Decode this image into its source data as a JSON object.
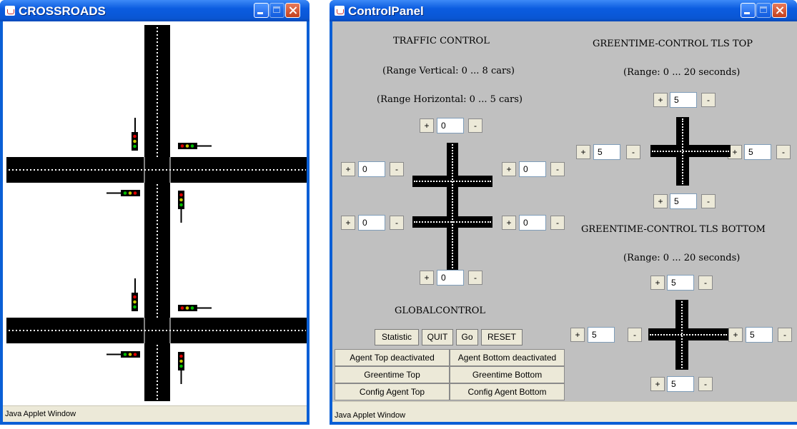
{
  "crossroads_window": {
    "title": "CROSSROADS",
    "status": "Java Applet Window"
  },
  "control_panel": {
    "title": "ControlPanel",
    "status": "Java Applet Window",
    "traffic": {
      "heading": "TRAFFIC CONTROL",
      "range_vertical": "(Range Vertical: 0 ... 8 cars)",
      "range_horizontal": "(Range Horizontal: 0 ... 5 cars)",
      "top": "0",
      "upper_left": "0",
      "upper_right": "0",
      "lower_left": "0",
      "lower_right": "0",
      "bottom": "0"
    },
    "global": {
      "heading": "GLOBALCONTROL",
      "statistic": "Statistic",
      "quit": "QUIT",
      "go": "Go",
      "reset": "RESET",
      "agent_top": "Agent Top deactivated",
      "agent_bottom": "Agent Bottom deactivated",
      "greentime_top": "Greentime Top",
      "greentime_bottom": "Greentime Bottom",
      "config_top": "Config Agent Top",
      "config_bottom": "Config Agent Bottom"
    },
    "tls_top": {
      "heading": "GREENTIME-CONTROL TLS TOP",
      "range": "(Range: 0 ... 20 seconds)",
      "north": "5",
      "west": "5",
      "east": "5",
      "south": "5"
    },
    "tls_bottom": {
      "heading": "GREENTIME-CONTROL TLS BOTTOM",
      "range": "(Range: 0 ... 20 seconds)",
      "north": "5",
      "west": "5",
      "east": "5",
      "south": "5"
    },
    "plus": "+",
    "minus": "-"
  },
  "colors": {
    "title_blue": "#0a56d3",
    "panel_grey": "#c0c0c0",
    "status_beige": "#ece9d8",
    "road": "#000000"
  }
}
